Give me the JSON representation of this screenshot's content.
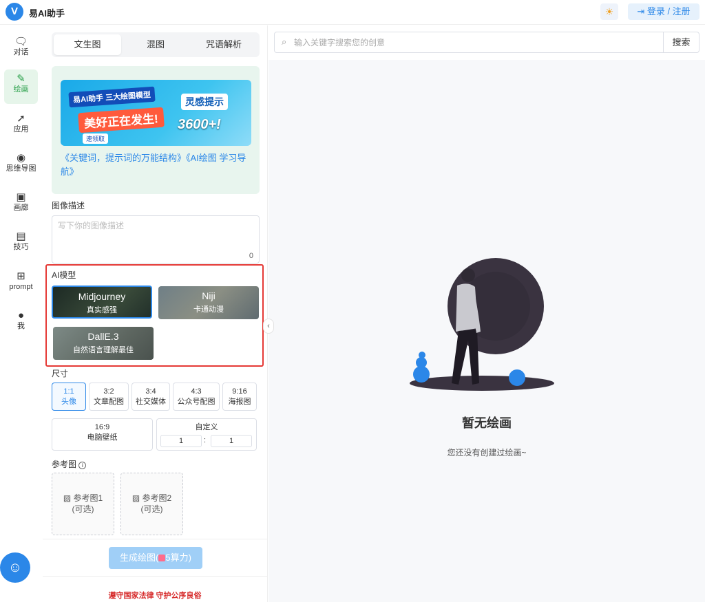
{
  "header": {
    "logo_letter": "V",
    "app_title": "易AI助手",
    "theme_icon": "sun-icon",
    "login_label": "登录 / 注册",
    "login_icon": "login-arrow-icon"
  },
  "nav": {
    "items": [
      {
        "label": "对话",
        "icon": "chat-icon"
      },
      {
        "label": "绘画",
        "icon": "brush-icon"
      },
      {
        "label": "应用",
        "icon": "rocket-icon"
      },
      {
        "label": "思维导图",
        "icon": "brain-icon"
      },
      {
        "label": "画廊",
        "icon": "gallery-icon"
      },
      {
        "label": "技巧",
        "icon": "book-icon"
      },
      {
        "label": "prompt",
        "icon": "gift-icon"
      },
      {
        "label": "我",
        "icon": "user-icon"
      }
    ],
    "active_index": 1,
    "help_icon": "robot-help-icon"
  },
  "tabs": [
    "文生图",
    "混图",
    "咒语解析"
  ],
  "promo": {
    "banner": {
      "line1": "易AI助手 三大绘图模型",
      "line2": "美好正在发生!",
      "line3": "灵感提示",
      "line4": "3600+!",
      "badge": "速领取"
    },
    "links_text": "《关键词，提示词的万能结构》《AI绘图 学习导航》"
  },
  "description": {
    "label": "图像描述",
    "placeholder": "写下你的图像描述",
    "count": "0"
  },
  "models": {
    "label": "AI模型",
    "items": [
      {
        "name": "Midjourney",
        "desc": "真实感强"
      },
      {
        "name": "Niji",
        "desc": "卡通动漫"
      },
      {
        "name": "DallE.3",
        "desc": "自然语言理解最佳"
      }
    ],
    "selected_index": 0
  },
  "size": {
    "label": "尺寸",
    "options": [
      {
        "ratio": "1:1",
        "use": "头像"
      },
      {
        "ratio": "3:2",
        "use": "文章配图"
      },
      {
        "ratio": "3:4",
        "use": "社交媒体"
      },
      {
        "ratio": "4:3",
        "use": "公众号配图"
      },
      {
        "ratio": "9:16",
        "use": "海报图"
      },
      {
        "ratio": "16:9",
        "use": "电脑壁纸"
      }
    ],
    "selected_index": 0,
    "custom": {
      "label": "自定义",
      "width": "1",
      "height": "1",
      "separator": ":"
    }
  },
  "reference": {
    "label": "参考图",
    "info_icon": "info-icon",
    "items": [
      {
        "title": "参考图1",
        "note": "(可选)"
      },
      {
        "title": "参考图2",
        "note": "(可选)"
      }
    ]
  },
  "generate": {
    "label_prefix": "生成绘图(",
    "label_suffix": "5算力)"
  },
  "legal": "遵守国家法律   守护公序良俗",
  "main": {
    "search_placeholder": "输入关键字搜索您的创意",
    "search_button": "搜索",
    "collapse_icon": "chevron-left-icon",
    "empty_title": "暂无绘画",
    "empty_subtitle": "您还没有创建过绘画~"
  },
  "colors": {
    "accent": "#2b87e8",
    "active_nav": "#2aa04a",
    "highlight_frame": "#e53935",
    "legal_text": "#d62a2a"
  }
}
